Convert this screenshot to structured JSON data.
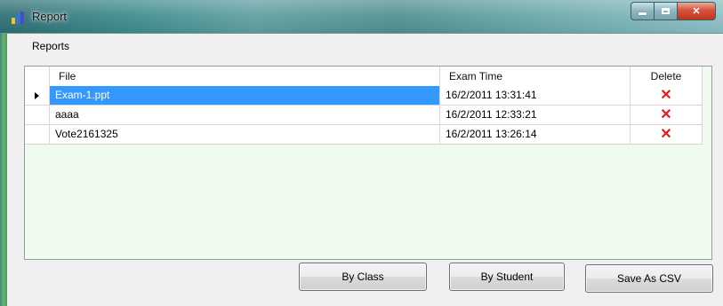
{
  "window": {
    "title": "Report",
    "controls": {
      "minimize": "minimize",
      "maximize": "maximize",
      "close": "✕"
    }
  },
  "menu": {
    "items": [
      {
        "label": "Reports"
      }
    ]
  },
  "grid": {
    "columns": [
      {
        "label": "File"
      },
      {
        "label": "Exam Time"
      },
      {
        "label": "Delete"
      }
    ],
    "rows": [
      {
        "file": "Exam-1.ppt",
        "exam_time": "16/2/2011 13:31:41",
        "delete_icon": "✕",
        "selected": true
      },
      {
        "file": "aaaa",
        "exam_time": "16/2/2011 12:33:21",
        "delete_icon": "✕",
        "selected": false
      },
      {
        "file": "Vote2161325",
        "exam_time": "16/2/2011 13:26:14",
        "delete_icon": "✕",
        "selected": false
      }
    ]
  },
  "buttons": {
    "by_class": "By Class",
    "by_student": "By Student",
    "save_csv": "Save As CSV"
  },
  "colors": {
    "selection": "#3399ff",
    "grid_background": "#f0fbf0",
    "delete_red": "#e11a1a"
  }
}
